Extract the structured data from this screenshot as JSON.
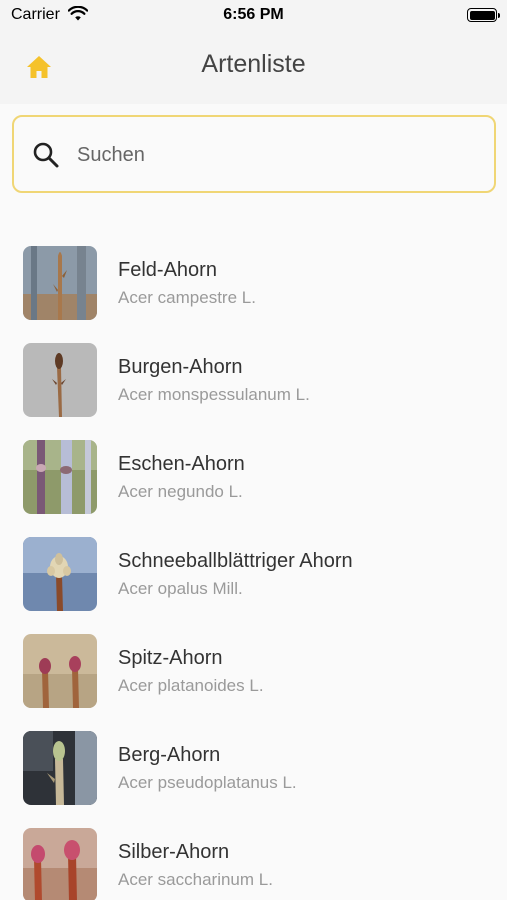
{
  "status_bar": {
    "carrier": "Carrier",
    "time": "6:56 PM"
  },
  "header": {
    "title": "Artenliste",
    "home_icon": "home-icon"
  },
  "search": {
    "placeholder": "Suchen",
    "value": "",
    "icon": "search-icon"
  },
  "colors": {
    "accent": "#f5c22b",
    "search_border": "#f0d675"
  },
  "species": [
    {
      "common": "Feld-Ahorn",
      "latin": "Acer campestre L."
    },
    {
      "common": "Burgen-Ahorn",
      "latin": "Acer monspessulanum L."
    },
    {
      "common": "Eschen-Ahorn",
      "latin": "Acer negundo L."
    },
    {
      "common": "Schneeballblättriger Ahorn",
      "latin": "Acer opalus Mill."
    },
    {
      "common": "Spitz-Ahorn",
      "latin": "Acer platanoides L."
    },
    {
      "common": "Berg-Ahorn",
      "latin": "Acer pseudoplatanus L."
    },
    {
      "common": "Silber-Ahorn",
      "latin": "Acer saccharinum L."
    }
  ]
}
